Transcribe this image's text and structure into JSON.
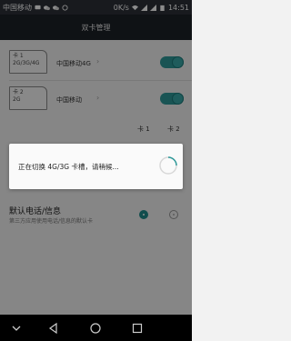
{
  "status_bar": {
    "carrier": "中国移动",
    "net_speed": "0K/s",
    "time": "14:51"
  },
  "title": "双卡管理",
  "sims": [
    {
      "slot": "卡 1",
      "network": "2G/3G/4G",
      "operator": "中国移动4G",
      "enabled": true
    },
    {
      "slot": "卡 2",
      "network": "2G",
      "operator": "中国移动",
      "enabled": true
    }
  ],
  "columns": {
    "card1": "卡 1",
    "card2": "卡 2"
  },
  "default_section": {
    "title": "默认电话/信息",
    "subtitle": "第三方应用使用电话/信息的默认卡",
    "selected": "卡 1"
  },
  "dialog": {
    "message": "正在切换 4G/3G 卡槽，请稍候..."
  },
  "colors": {
    "accent": "#2f9a9a",
    "titlebar": "#1d2127"
  },
  "icons": {
    "chevron": "chevron-right-icon",
    "back": "back-icon",
    "home": "home-icon",
    "recents": "recents-icon"
  }
}
